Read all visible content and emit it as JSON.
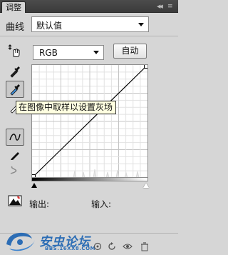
{
  "tab": {
    "label": "调整"
  },
  "preset": {
    "label": "曲线",
    "value": "默认值"
  },
  "channel": {
    "value": "RGB"
  },
  "auto_button": {
    "label": "自动"
  },
  "tooltip": {
    "text": "在图像中取样以设置灰场"
  },
  "io": {
    "output_label": "输出:",
    "input_label": "输入:"
  },
  "watermark": {
    "title": "安虫论坛",
    "subtitle": "BBS.16XX8.COM"
  },
  "curve": {
    "points": [
      [
        0,
        0
      ],
      [
        255,
        255
      ]
    ]
  },
  "colors": {
    "panel_bg": "#d6d6d6",
    "tab_bar": "#434343",
    "tooltip_bg": "#ffffe1",
    "watermark": "#2c6db5"
  },
  "icons": [
    "on-image-adjust-icon",
    "black-point-eyedropper-icon",
    "gray-point-eyedropper-icon",
    "white-point-eyedropper-icon",
    "curve-edit-icon",
    "pencil-icon",
    "smooth-icon",
    "clipping-warning-icon"
  ]
}
